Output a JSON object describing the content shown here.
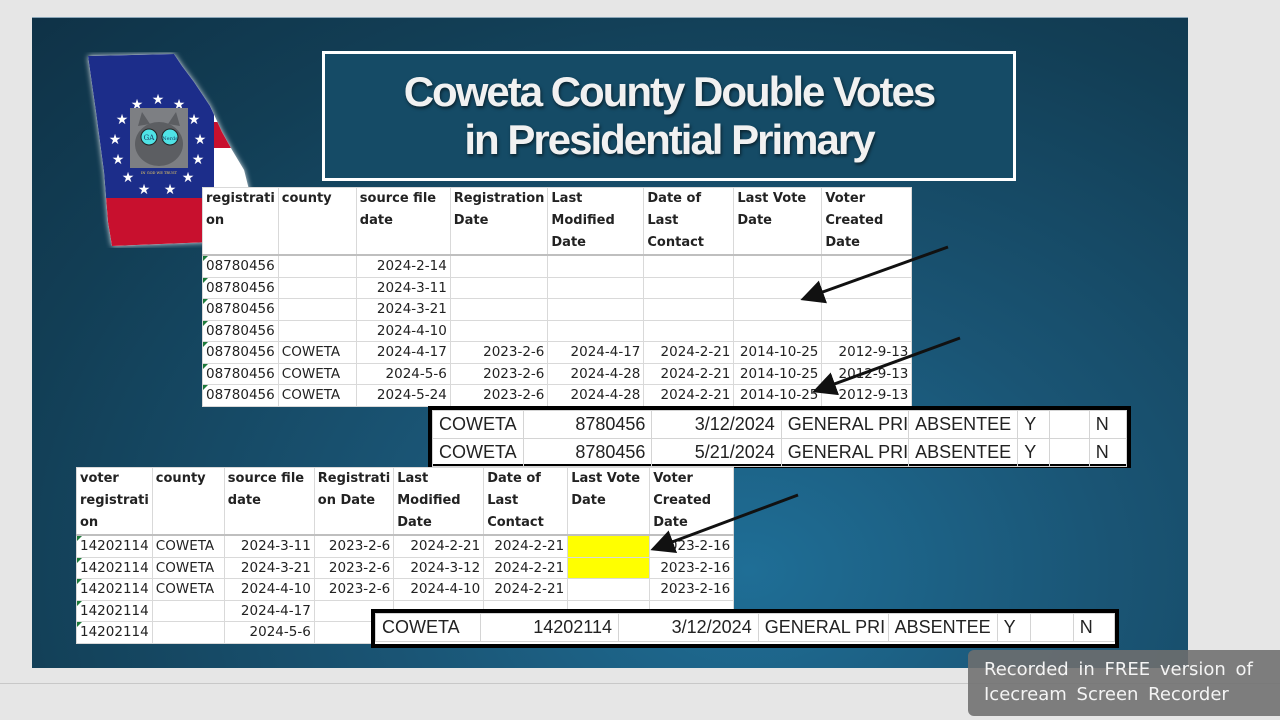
{
  "slide": {
    "title_lines": [
      "Coweta County Double Votes",
      "in Presidential Primary"
    ],
    "logo": {
      "icon": "georgia-flag-map-icon",
      "badge_text": [
        "GA",
        "Nerds"
      ],
      "motto": "IN GOD WE TRUST"
    }
  },
  "table_top": {
    "headers": [
      "registrati on",
      "county",
      "source file date",
      "Registration Date",
      "Last Modified Date",
      "Date of Last Contact",
      "Last Vote Date",
      "Voter Created Date"
    ],
    "rows": [
      [
        "08780456",
        "",
        "2024-2-14",
        "",
        "",
        "",
        "",
        ""
      ],
      [
        "08780456",
        "",
        "2024-3-11",
        "",
        "",
        "",
        "",
        ""
      ],
      [
        "08780456",
        "",
        "2024-3-21",
        "",
        "",
        "",
        "",
        ""
      ],
      [
        "08780456",
        "",
        "2024-4-10",
        "",
        "",
        "",
        "",
        ""
      ],
      [
        "08780456",
        "COWETA",
        "2024-4-17",
        "2023-2-6",
        "2024-4-17",
        "2024-2-21",
        "2014-10-25",
        "2012-9-13"
      ],
      [
        "08780456",
        "COWETA",
        "2024-5-6",
        "2023-2-6",
        "2024-4-28",
        "2024-2-21",
        "2014-10-25",
        "2012-9-13"
      ],
      [
        "08780456",
        "COWETA",
        "2024-5-24",
        "2023-2-6",
        "2024-4-28",
        "2024-2-21",
        "2014-10-25",
        "2012-9-13"
      ]
    ]
  },
  "votes_top": {
    "rows": [
      [
        "COWETA",
        "8780456",
        "3/12/2024",
        "GENERAL PRI",
        "ABSENTEE",
        "Y",
        "",
        "N"
      ],
      [
        "COWETA",
        "8780456",
        "5/21/2024",
        "GENERAL PRI",
        "ABSENTEE",
        "Y",
        "",
        "N"
      ]
    ]
  },
  "table_bottom": {
    "headers": [
      "voter registrati on",
      "county",
      "source file date",
      "Registrati on Date",
      "Last Modified Date",
      "Date of Last Contact",
      "Last Vote Date",
      "Voter Created Date"
    ],
    "rows": [
      [
        "14202114",
        "COWETA",
        "2024-3-11",
        "2023-2-6",
        "2024-2-21",
        "2024-2-21",
        "",
        "2023-2-16"
      ],
      [
        "14202114",
        "COWETA",
        "2024-3-21",
        "2023-2-6",
        "2024-3-12",
        "2024-2-21",
        "",
        "2023-2-16"
      ],
      [
        "14202114",
        "COWETA",
        "2024-4-10",
        "2023-2-6",
        "2024-4-10",
        "2024-2-21",
        "",
        "2023-2-16"
      ],
      [
        "14202114",
        "",
        "2024-4-17",
        "",
        "",
        "",
        "",
        ""
      ],
      [
        "14202114",
        "",
        "2024-5-6",
        "",
        "",
        "",
        "",
        ""
      ]
    ],
    "highlight_color": "#ffff00"
  },
  "votes_bottom": {
    "rows": [
      [
        "COWETA",
        "14202114",
        "3/12/2024",
        "GENERAL PRI",
        "ABSENTEE",
        "Y",
        "",
        "N"
      ]
    ]
  },
  "watermark": {
    "line1": "Recorded in FREE version of",
    "line2": "Icecream  Screen  Recorder"
  }
}
